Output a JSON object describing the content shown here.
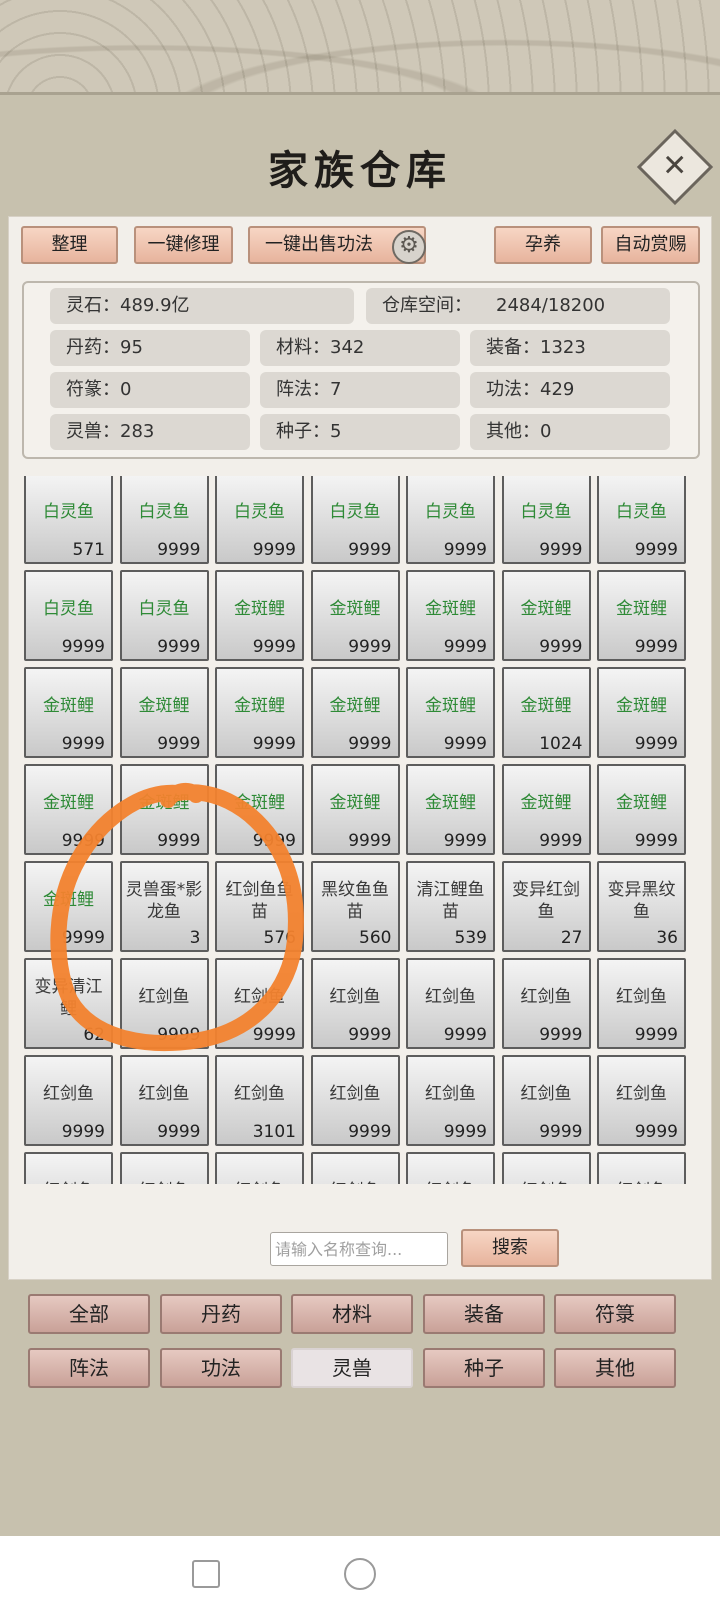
{
  "title": "家族仓库",
  "toolbar": {
    "organize": "整理",
    "repair_all": "一键修理",
    "sell_skills": "一键出售功法",
    "breed": "孕养",
    "auto_reward": "自动赏赐"
  },
  "stats": {
    "spirit_stone": "灵石：489.9亿",
    "warehouse_space_label": "仓库空间：",
    "warehouse_space_value": "2484/18200",
    "pills": "丹药：95",
    "materials": "材料：342",
    "equipment": "装备：1323",
    "talismans": "符篆：0",
    "formations": "阵法：7",
    "skills": "功法：429",
    "beasts": "灵兽：283",
    "seeds": "种子：5",
    "others": "其他：0"
  },
  "items": [
    {
      "name": "白灵鱼",
      "count": "571",
      "green": true
    },
    {
      "name": "白灵鱼",
      "count": "9999",
      "green": true
    },
    {
      "name": "白灵鱼",
      "count": "9999",
      "green": true
    },
    {
      "name": "白灵鱼",
      "count": "9999",
      "green": true
    },
    {
      "name": "白灵鱼",
      "count": "9999",
      "green": true
    },
    {
      "name": "白灵鱼",
      "count": "9999",
      "green": true
    },
    {
      "name": "白灵鱼",
      "count": "9999",
      "green": true
    },
    {
      "name": "白灵鱼",
      "count": "9999",
      "green": true
    },
    {
      "name": "白灵鱼",
      "count": "9999",
      "green": true
    },
    {
      "name": "金斑鲤",
      "count": "9999",
      "green": true
    },
    {
      "name": "金斑鲤",
      "count": "9999",
      "green": true
    },
    {
      "name": "金斑鲤",
      "count": "9999",
      "green": true
    },
    {
      "name": "金斑鲤",
      "count": "9999",
      "green": true
    },
    {
      "name": "金斑鲤",
      "count": "9999",
      "green": true
    },
    {
      "name": "金斑鲤",
      "count": "9999",
      "green": true
    },
    {
      "name": "金斑鲤",
      "count": "9999",
      "green": true
    },
    {
      "name": "金斑鲤",
      "count": "9999",
      "green": true
    },
    {
      "name": "金斑鲤",
      "count": "9999",
      "green": true
    },
    {
      "name": "金斑鲤",
      "count": "9999",
      "green": true
    },
    {
      "name": "金斑鲤",
      "count": "1024",
      "green": true
    },
    {
      "name": "金斑鲤",
      "count": "9999",
      "green": true
    },
    {
      "name": "金斑鲤",
      "count": "9999",
      "green": true
    },
    {
      "name": "金斑鲤",
      "count": "9999",
      "green": true
    },
    {
      "name": "金斑鲤",
      "count": "9999",
      "green": true
    },
    {
      "name": "金斑鲤",
      "count": "9999",
      "green": true
    },
    {
      "name": "金斑鲤",
      "count": "9999",
      "green": true
    },
    {
      "name": "金斑鲤",
      "count": "9999",
      "green": true
    },
    {
      "name": "金斑鲤",
      "count": "9999",
      "green": true
    },
    {
      "name": "金斑鲤",
      "count": "9999",
      "green": true
    },
    {
      "name": "灵兽蛋*影龙鱼",
      "count": "3",
      "green": false
    },
    {
      "name": "红剑鱼鱼苗",
      "count": "576",
      "green": false
    },
    {
      "name": "黑纹鱼鱼苗",
      "count": "560",
      "green": false
    },
    {
      "name": "清江鲤鱼苗",
      "count": "539",
      "green": false
    },
    {
      "name": "变异红剑鱼",
      "count": "27",
      "green": false
    },
    {
      "name": "变异黑纹鱼",
      "count": "36",
      "green": false
    },
    {
      "name": "变异清江鲤",
      "count": "62",
      "green": false
    },
    {
      "name": "红剑鱼",
      "count": "9999",
      "green": false
    },
    {
      "name": "红剑鱼",
      "count": "9999",
      "green": false
    },
    {
      "name": "红剑鱼",
      "count": "9999",
      "green": false
    },
    {
      "name": "红剑鱼",
      "count": "9999",
      "green": false
    },
    {
      "name": "红剑鱼",
      "count": "9999",
      "green": false
    },
    {
      "name": "红剑鱼",
      "count": "9999",
      "green": false
    },
    {
      "name": "红剑鱼",
      "count": "9999",
      "green": false
    },
    {
      "name": "红剑鱼",
      "count": "9999",
      "green": false
    },
    {
      "name": "红剑鱼",
      "count": "3101",
      "green": false
    },
    {
      "name": "红剑鱼",
      "count": "9999",
      "green": false
    },
    {
      "name": "红剑鱼",
      "count": "9999",
      "green": false
    },
    {
      "name": "红剑鱼",
      "count": "9999",
      "green": false
    },
    {
      "name": "红剑鱼",
      "count": "9999",
      "green": false
    },
    {
      "name": "红剑鱼",
      "count": "",
      "green": false
    },
    {
      "name": "红剑鱼",
      "count": "",
      "green": false
    },
    {
      "name": "红剑鱼",
      "count": "",
      "green": false
    },
    {
      "name": "红剑鱼",
      "count": "",
      "green": false
    },
    {
      "name": "红剑鱼",
      "count": "",
      "green": false
    },
    {
      "name": "红剑鱼",
      "count": "",
      "green": false
    },
    {
      "name": "红剑鱼",
      "count": "",
      "green": false
    }
  ],
  "search": {
    "placeholder": "请输入名称查询...",
    "button": "搜索"
  },
  "tabs": [
    "全部",
    "丹药",
    "材料",
    "装备",
    "符箓",
    "阵法",
    "功法",
    "灵兽",
    "种子",
    "其他"
  ],
  "active_tab": "灵兽",
  "colors": {
    "button_fill": "#e7b49d",
    "item_green": "#2e8a36",
    "annotation_orange": "#f2822e"
  }
}
